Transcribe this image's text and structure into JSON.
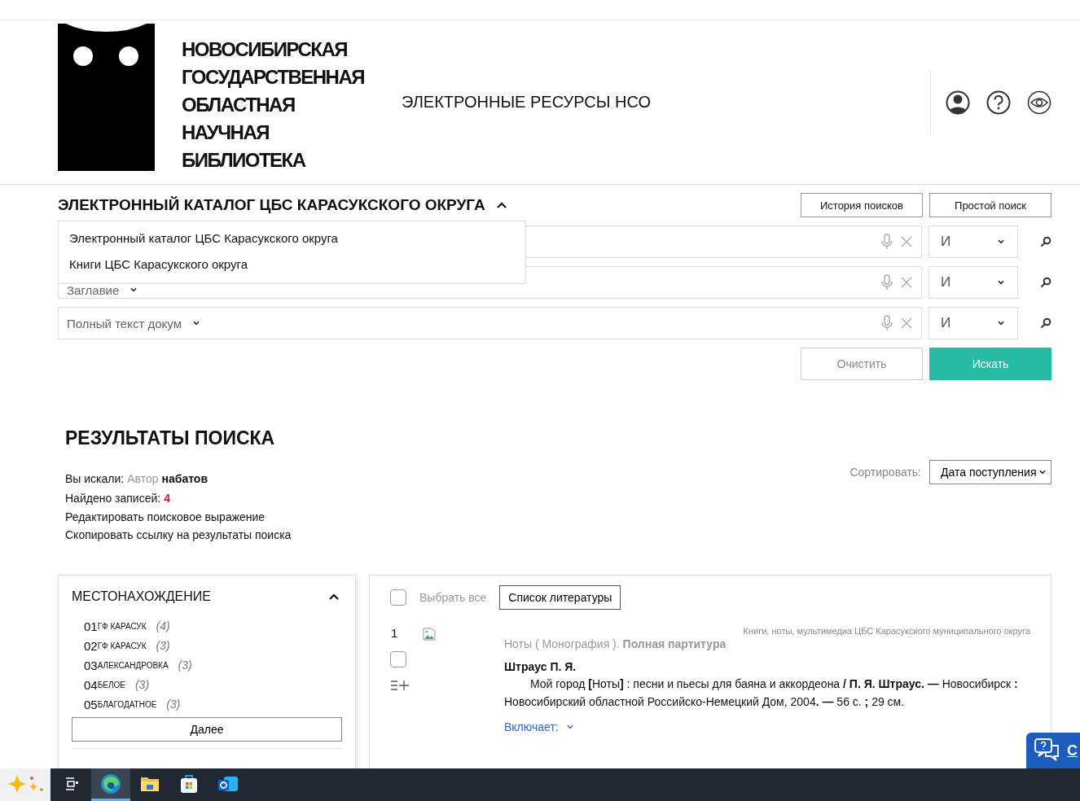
{
  "header": {
    "logo_lines": [
      "НОВОСИБИРСКАЯ",
      "ГОСУДАРСТВЕННАЯ",
      "ОБЛАСТНАЯ",
      "НАУЧНАЯ",
      "БИБЛИОТЕКА"
    ],
    "site_title": "ЭЛЕКТРОННЫЕ РЕСУРСЫ НСО"
  },
  "catalog": {
    "title": "ЭЛЕКТРОННЫЙ КАТАЛОГ ЦБС КАРАСУКСКОГО ОКРУГА",
    "expanded": true,
    "options": [
      {
        "label": "Электронный каталог ЦБС Карасукского округа"
      },
      {
        "label": "Книги ЦБС Карасукского округа"
      }
    ]
  },
  "top_buttons": [
    "История поисков",
    "Простой поиск"
  ],
  "search_rows": [
    {
      "operator": "И"
    },
    {
      "field": "Заглавие",
      "operator": "И"
    },
    {
      "field": "Полный текст докум",
      "operator": "И"
    }
  ],
  "actions": {
    "clear": "Очистить",
    "search": "Искать"
  },
  "results": {
    "title": "РЕЗУЛЬТАТЫ ПОИСКА",
    "query_label": "Вы искали:",
    "query_field": "Автор",
    "query_value": "набатов",
    "found_label": "Найдено записей:",
    "found_count": "4",
    "links": [
      "Редактировать поисковое выражение",
      "Скопировать ссылку на результаты поиска"
    ],
    "sort_label": "Сортировать:",
    "sort_value": "Дата поступления"
  },
  "facet": {
    "title": "МЕСТОНАХОЖДЕНИЕ",
    "expanded": true,
    "items": [
      {
        "code": "01",
        "name": "ГФ КАРАСУК",
        "count": "(4)"
      },
      {
        "code": "02",
        "name": "ГФ КАРАСУК",
        "count": "(3)"
      },
      {
        "code": "03",
        "name": "АЛЕКСАНДРОВКА",
        "count": "(3)"
      },
      {
        "code": "04",
        "name": "БЕЛОЕ",
        "count": "(3)"
      },
      {
        "code": "05",
        "name": "БЛАГОДАТНОЕ",
        "count": "(3)"
      }
    ],
    "more": "Далее"
  },
  "list": {
    "select_all": "Выбрать все",
    "select_all_checked": false,
    "bibliography": "Список литературы",
    "records": [
      {
        "number": "1",
        "checked": false,
        "source": "Книги, ноты, мультимедиа ЦБС Карасукского муниципального округа",
        "type": "Ноты ( Монография ). **Полная партитура**",
        "author": "Штраус П. Я.",
        "description": "Мой город **[**Ноты**]** : песни и пьесы для баяна и аккордеона **/ П. Я. Штраус. —** Новосибирск **:** Новосибирский областной Российско-Немецкий Дом, 2004**. —** 56 с. **;** 29 см.",
        "includes": "Включает:",
        "includes_expanded": false
      }
    ]
  },
  "chat": {
    "label": "С"
  },
  "taskbar": {
    "apps": [
      {
        "kind": "sparkle",
        "active": false
      },
      {
        "kind": "taskview",
        "active": false
      },
      {
        "kind": "browser",
        "active": true
      },
      {
        "kind": "folder",
        "active": false
      },
      {
        "kind": "store",
        "active": false
      },
      {
        "kind": "mail",
        "active": false
      }
    ]
  }
}
